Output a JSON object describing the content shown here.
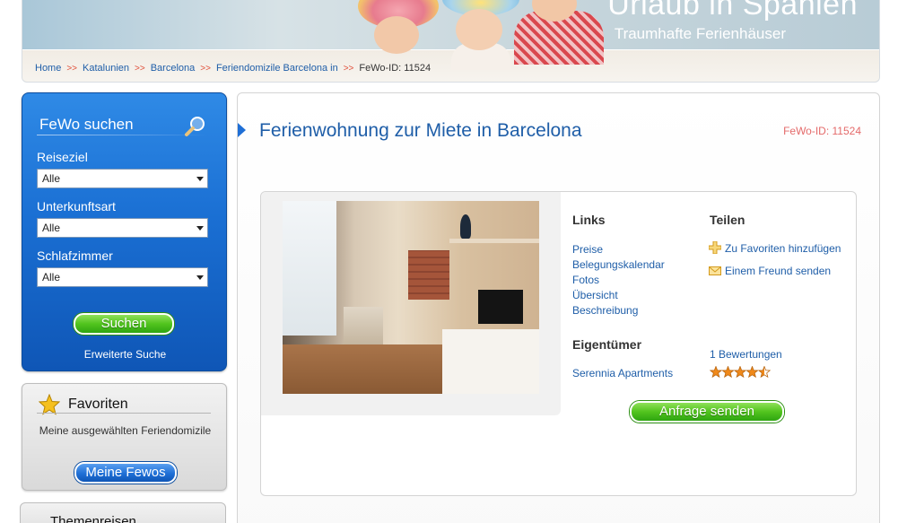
{
  "header": {
    "title": "Urlaub in Spanien",
    "subtitle": "Traumhafte Ferienhäuser"
  },
  "breadcrumb": {
    "items": [
      "Home",
      "Katalunien",
      "Barcelona",
      "Feriendomizile Barcelona in"
    ],
    "separator": ">>",
    "current": "FeWo-ID: 11524"
  },
  "search": {
    "title": "FeWo suchen",
    "fields": [
      {
        "label": "Reiseziel",
        "value": "Alle"
      },
      {
        "label": "Unterkunftsart",
        "value": "Alle"
      },
      {
        "label": "Schlafzimmer",
        "value": "Alle"
      }
    ],
    "button_label": "Suchen",
    "extended_link": "Erweiterte Suche"
  },
  "favorites": {
    "title": "Favoriten",
    "text": "Meine ausgewählten Feriendomizile",
    "button_label": "Meine Fewos"
  },
  "themen": {
    "title": "Themenreisen"
  },
  "main": {
    "title": "Ferienwohnung zur Miete in Barcelona",
    "fewo_id": "FeWo-ID: 11524",
    "links": {
      "heading": "Links",
      "items": [
        "Preise",
        "Belegungskalendar",
        "Fotos",
        "Übersicht",
        "Beschreibung"
      ]
    },
    "share": {
      "heading": "Teilen",
      "favorite_label": "Zu Favoriten hinzufügen",
      "friend_label": "Einem Freund senden"
    },
    "owner": {
      "heading": "Eigentümer",
      "name": "Serennia Apartments"
    },
    "rating": {
      "reviews_label": "1 Bewertungen",
      "stars": 4.5,
      "max_stars": 5
    },
    "inquiry_button": "Anfrage senden"
  },
  "colors": {
    "link": "#1f5ea8",
    "accent_blue": "#1f6fd6",
    "accent_green": "#52c41e",
    "fewo_id_red": "#e46a6a",
    "star_orange": "#f0891a"
  },
  "icons": {
    "search": "magnifier-icon",
    "favorites": "star-icon",
    "add_favorite": "plus-icon",
    "send_friend": "envelope-icon"
  }
}
